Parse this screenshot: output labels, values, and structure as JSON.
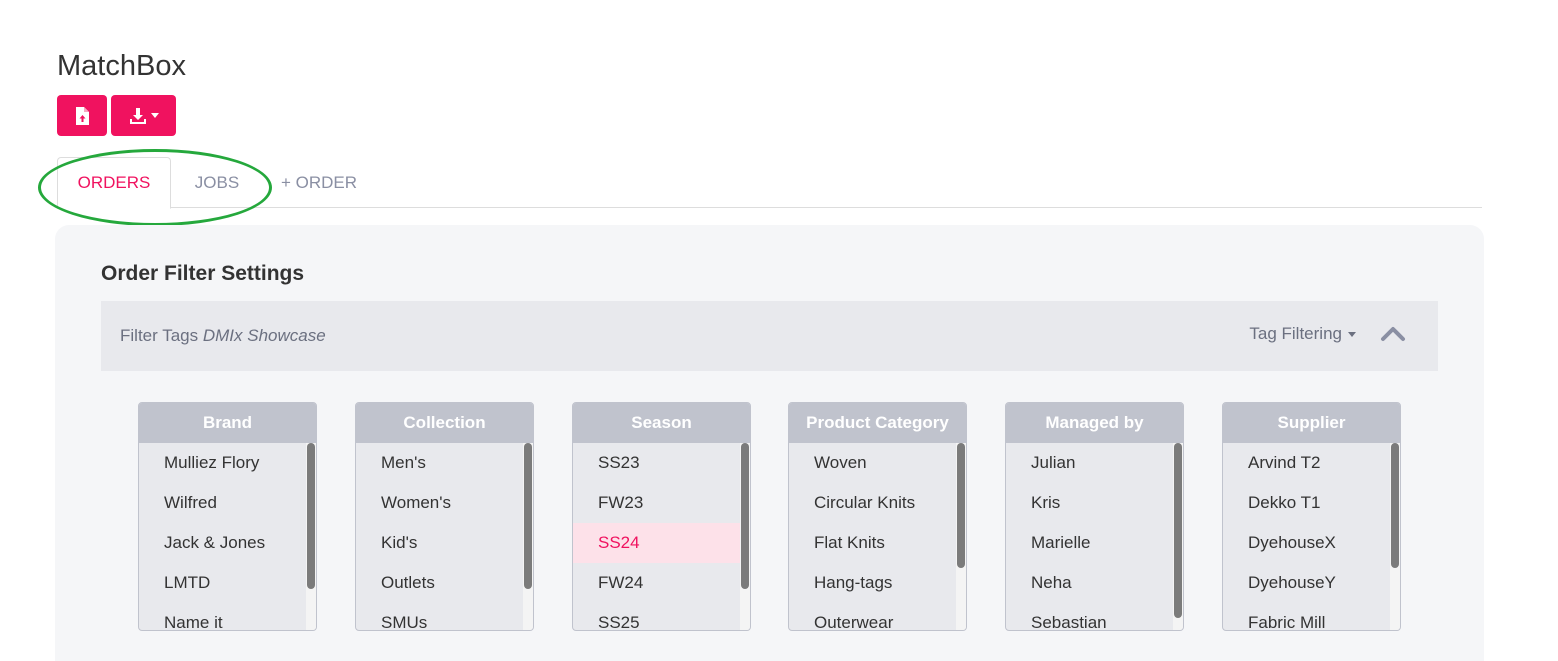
{
  "app": {
    "title": "MatchBox"
  },
  "toolbar": {
    "upload_icon": "file-upload-icon",
    "download_icon": "download-icon",
    "accent_color": "#f0125f"
  },
  "tabs": [
    {
      "label": "ORDERS",
      "active": true
    },
    {
      "label": "JOBS",
      "active": false
    },
    {
      "label": "+ ORDER",
      "active": false
    }
  ],
  "panel": {
    "title": "Order Filter Settings",
    "filter_tags_label": "Filter Tags",
    "filter_tags_value": "DMIx Showcase",
    "tag_filtering_label": "Tag Filtering",
    "collapse_icon": "chevron-up-icon"
  },
  "filters": [
    {
      "header": "Brand",
      "items": [
        "Mulliez Flory",
        "Wilfred",
        "Jack & Jones",
        "LMTD",
        "Name it"
      ],
      "selected": null
    },
    {
      "header": "Collection",
      "items": [
        "Men's",
        "Women's",
        "Kid's",
        "Outlets",
        "SMUs"
      ],
      "selected": null
    },
    {
      "header": "Season",
      "items": [
        "SS23",
        "FW23",
        "SS24",
        "FW24",
        "SS25"
      ],
      "selected": 2
    },
    {
      "header": "Product Category",
      "items": [
        "Woven",
        "Circular Knits",
        "Flat Knits",
        "Hang-tags",
        "Outerwear"
      ],
      "selected": null
    },
    {
      "header": "Managed by",
      "items": [
        "Julian",
        "Kris",
        "Marielle",
        "Neha",
        "Sebastian"
      ],
      "selected": null
    },
    {
      "header": "Supplier",
      "items": [
        "Arvind T2",
        "Dekko T1",
        "DyehouseX",
        "DyehouseY",
        "Fabric Mill"
      ],
      "selected": null
    }
  ]
}
